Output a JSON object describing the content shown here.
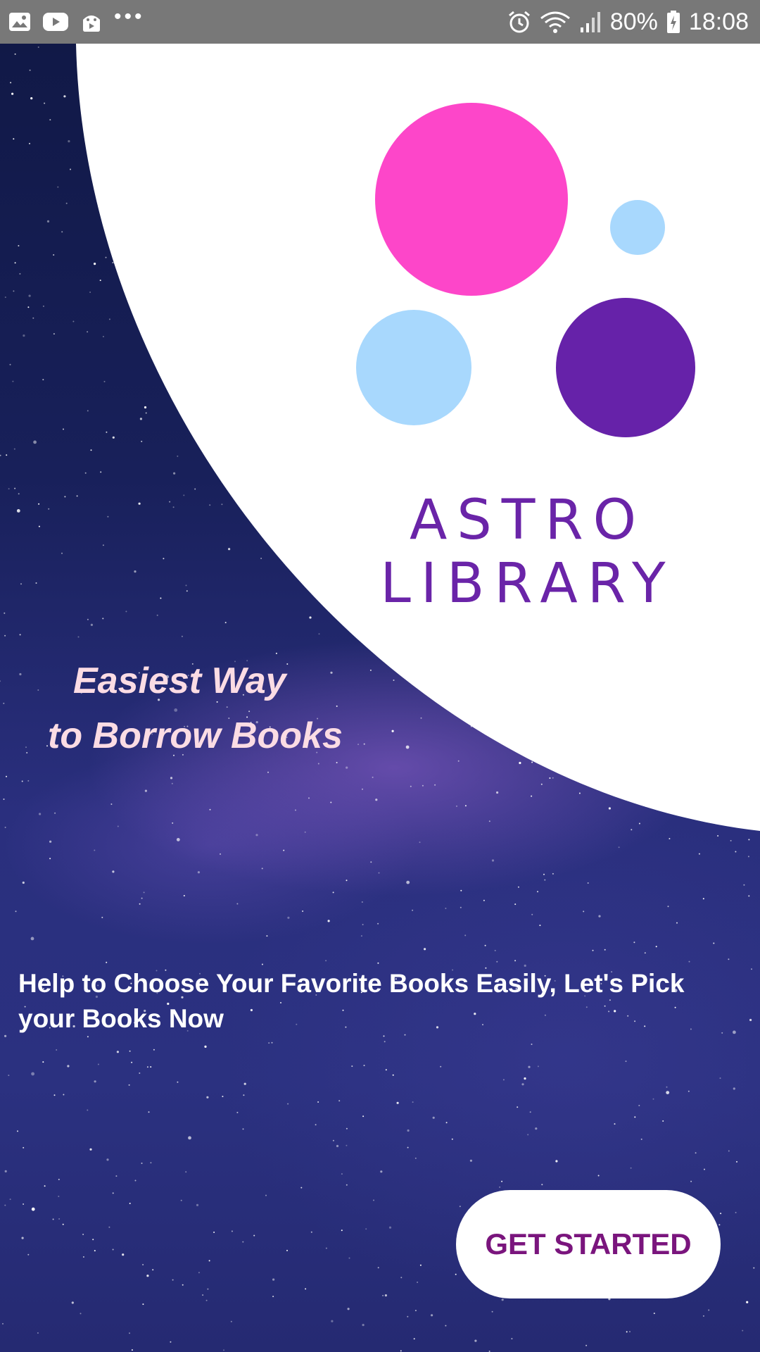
{
  "status_bar": {
    "icons_left": [
      "gallery-icon",
      "youtube-icon",
      "android-icon",
      "more-dots-icon"
    ],
    "more_text": "•••",
    "icons_right": [
      "alarm-icon",
      "wifi-icon",
      "signal-icon",
      "battery-icon"
    ],
    "battery_percent": "80%",
    "time": "18:08"
  },
  "logo": {
    "line1": "ASTRO",
    "line2": "LIBRARY",
    "colors": {
      "pink": "#fd46c9",
      "light_blue": "#a8d8fd",
      "purple": "#6622a9",
      "text": "#6a24a8"
    }
  },
  "tagline": {
    "line1": "Easiest Way",
    "line2": "to Borrow Books"
  },
  "description": "Help to Choose Your Favorite Books Easily, Let's Pick your Books Now",
  "cta": {
    "label": "GET STARTED"
  },
  "colors": {
    "accent": "#7a157d",
    "tagline": "#fbdce4",
    "status_bar": "#787878"
  }
}
